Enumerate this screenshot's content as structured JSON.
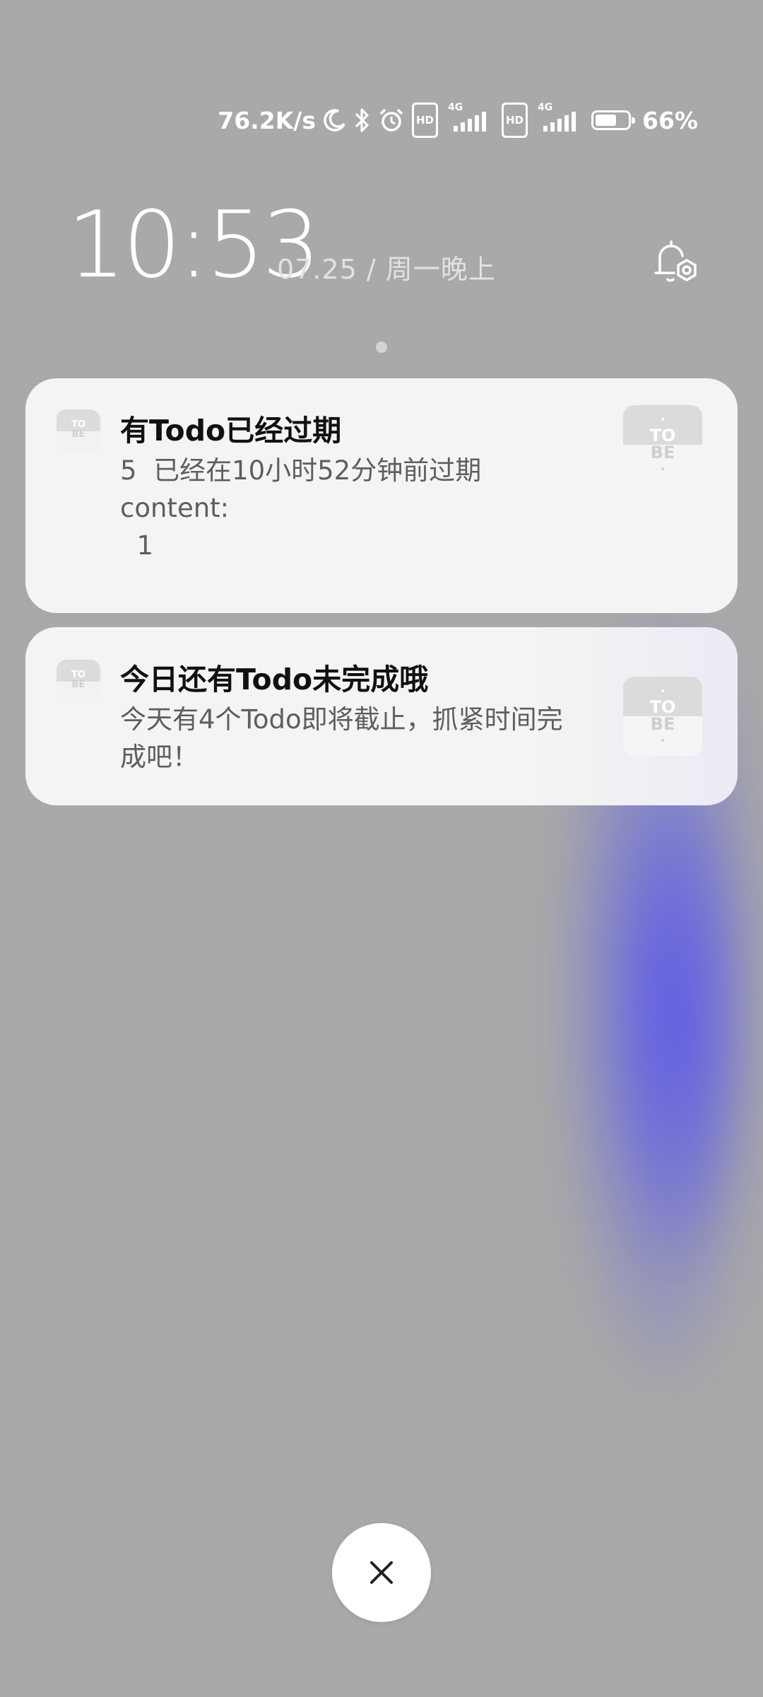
{
  "statusbar": {
    "net_speed": "76.2K/s",
    "hd_label": "HD",
    "network_type": "4G",
    "battery_percent": "66%",
    "battery_level": 0.66
  },
  "lockscreen": {
    "time": "10:53",
    "date": "07.25 / 周一晚上"
  },
  "notifications": [
    {
      "app_icon_text": "TO BE",
      "title": "有Todo已经过期",
      "body": "5  已经在10小时52分钟前过期\ncontent:\n  1"
    },
    {
      "app_icon_text": "TO BE",
      "title": "今日还有Todo未完成哦",
      "body": "今天有4个Todo即将截止，抓紧时间完\n成吧！"
    }
  ],
  "icons": {
    "close": "close-icon",
    "bell": "notification-settings-icon"
  }
}
